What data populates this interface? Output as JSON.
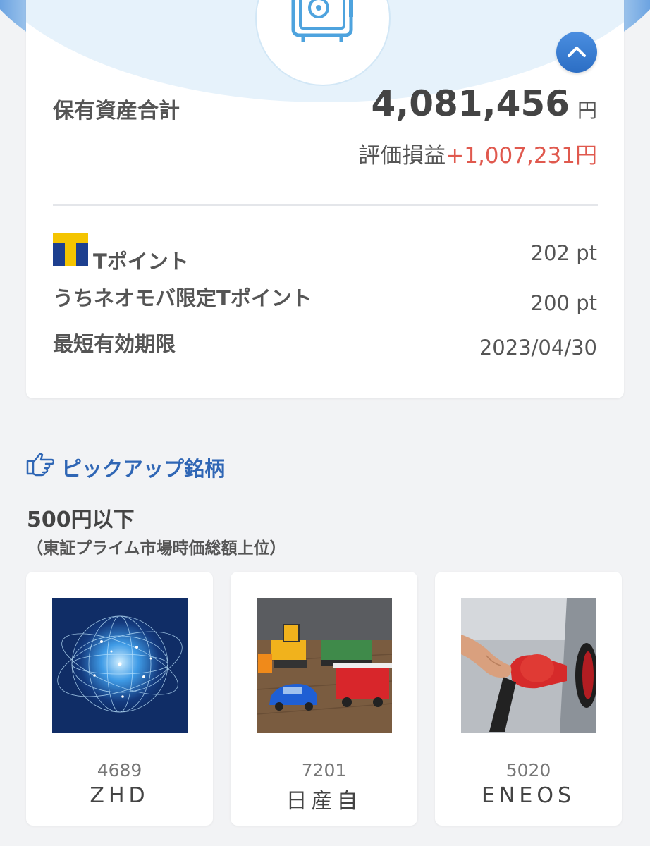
{
  "assets": {
    "total_label": "保有資産合計",
    "total_value": "4,081,456",
    "currency_unit": "円",
    "gain_label": "評価損益",
    "gain_value": "+1,007,231円",
    "gain_color": "#e0594e"
  },
  "points": {
    "tpoint_label": "Tポイント",
    "tpoint_value": "202 pt",
    "limited_label": "うちネオモバ限定Tポイント",
    "limited_value": "200 pt",
    "expiry_label": "最短有効期限",
    "expiry_value": "2023/04/30"
  },
  "pickup": {
    "title": "ピックアップ銘柄",
    "heading": "500円以下",
    "note": "（東証プライム市場時価総額上位）",
    "stocks": [
      {
        "code": "4689",
        "name": "ZHD",
        "image": "globe-network-image"
      },
      {
        "code": "7201",
        "name": "日産自",
        "image": "toy-cars-image"
      },
      {
        "code": "5020",
        "name": "ENEOS",
        "image": "fuel-nozzle-image"
      }
    ]
  },
  "colors": {
    "accent": "#2f66b5",
    "button": "#3a7fd5",
    "background": "#f2f3f5"
  }
}
